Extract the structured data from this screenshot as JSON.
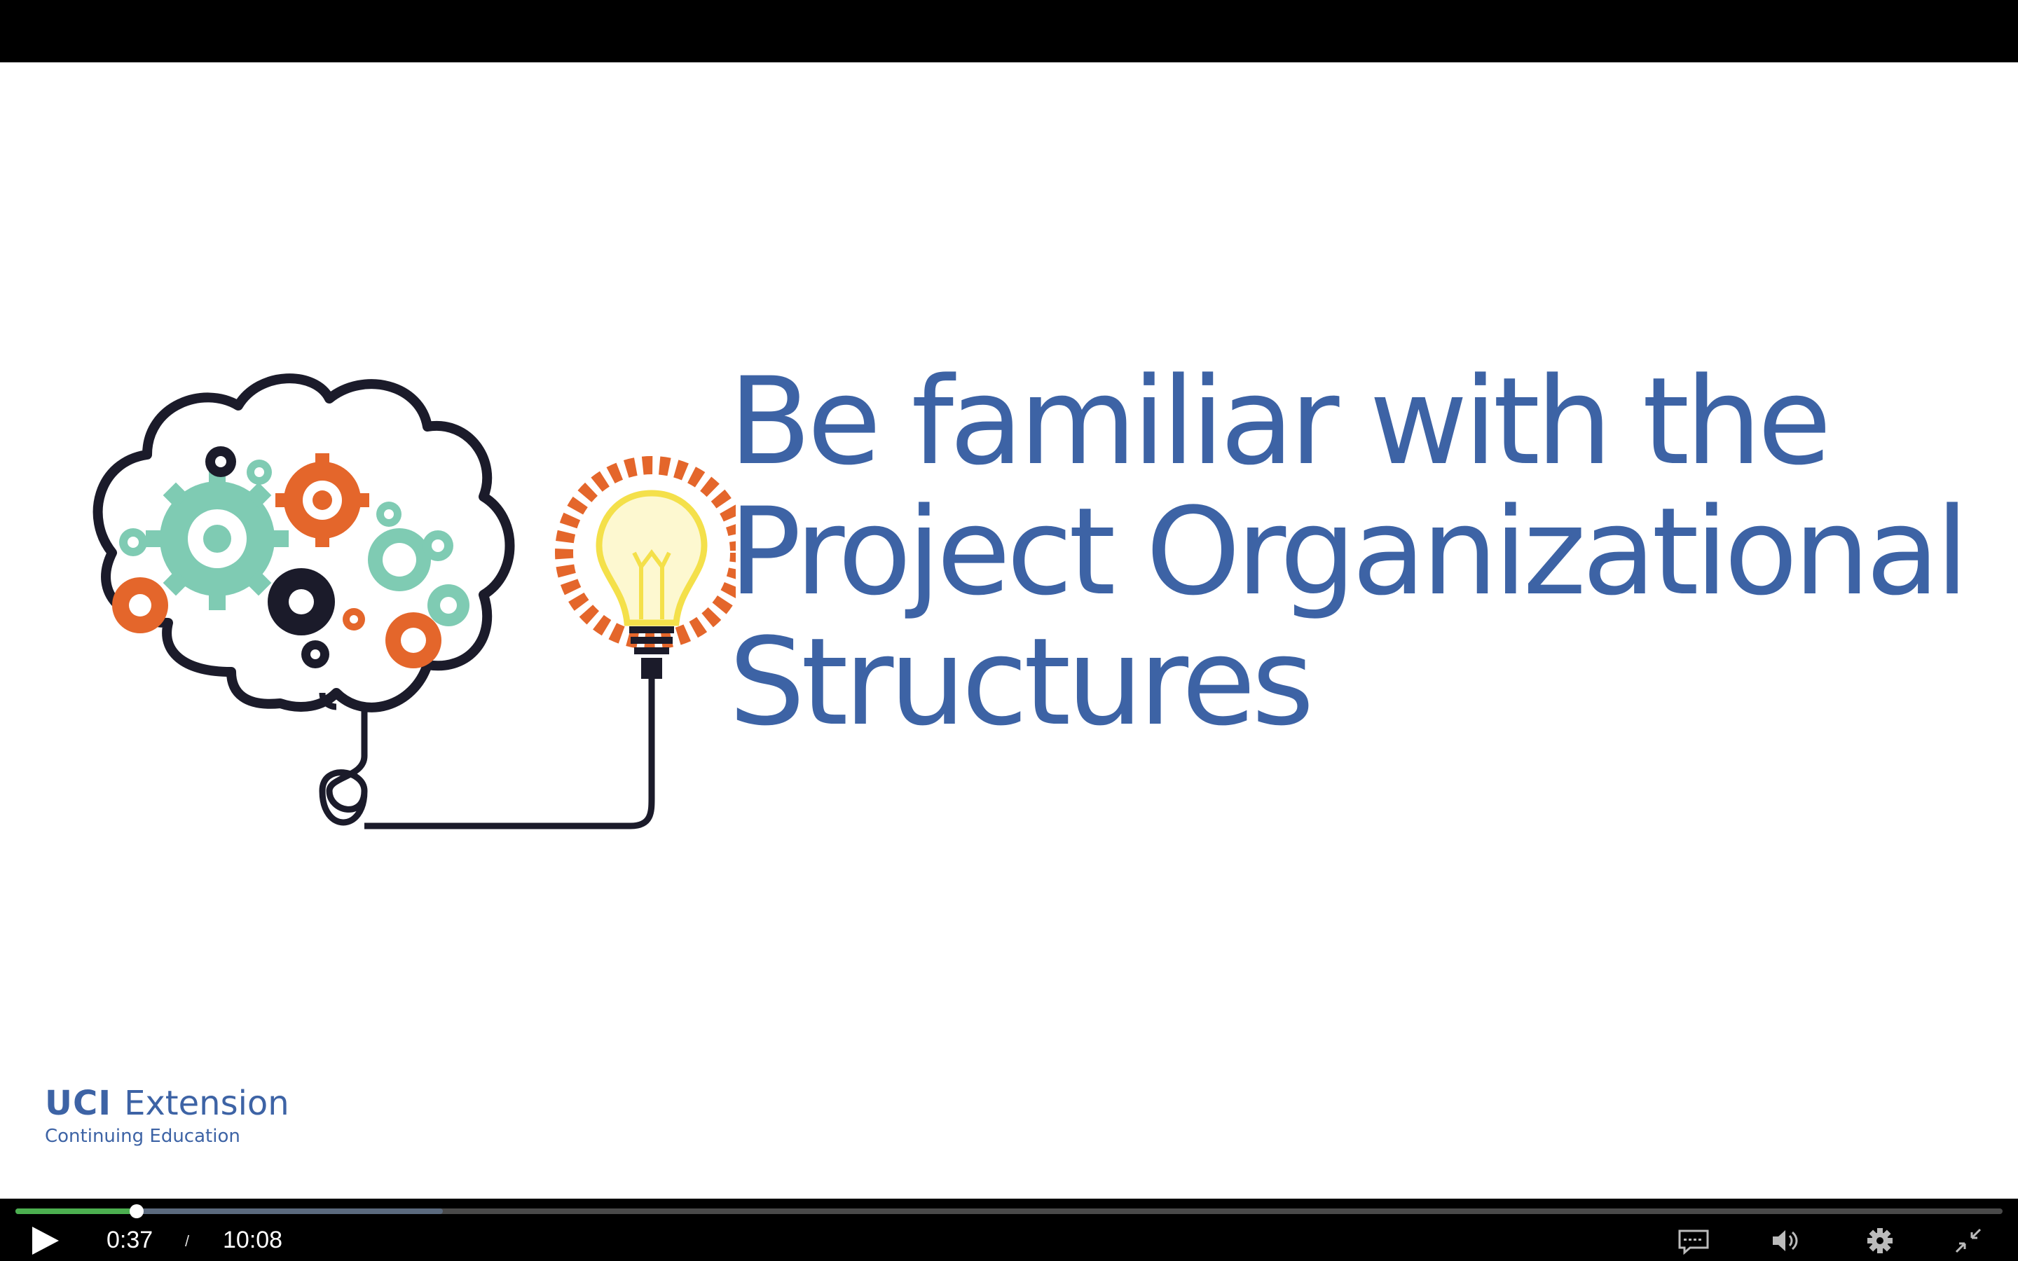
{
  "slide": {
    "title_lines": [
      "Be familiar with the",
      "Project Organizational",
      "Structures"
    ],
    "brand": {
      "name_bold": "UCI",
      "name_regular": "Extension",
      "subtitle": "Continuing Education"
    }
  },
  "player": {
    "current_time": "0:37",
    "separator": "/",
    "duration": "10:08",
    "progress_fraction": 0.061,
    "buffered_fraction": 0.215,
    "played_color": "#4caf50",
    "accent_text_color": "#3d63a5",
    "icons": {
      "play": "play-icon",
      "captions": "captions-icon",
      "volume": "volume-icon",
      "settings": "gear-icon",
      "exit_fullscreen": "exit-fullscreen-icon"
    }
  }
}
